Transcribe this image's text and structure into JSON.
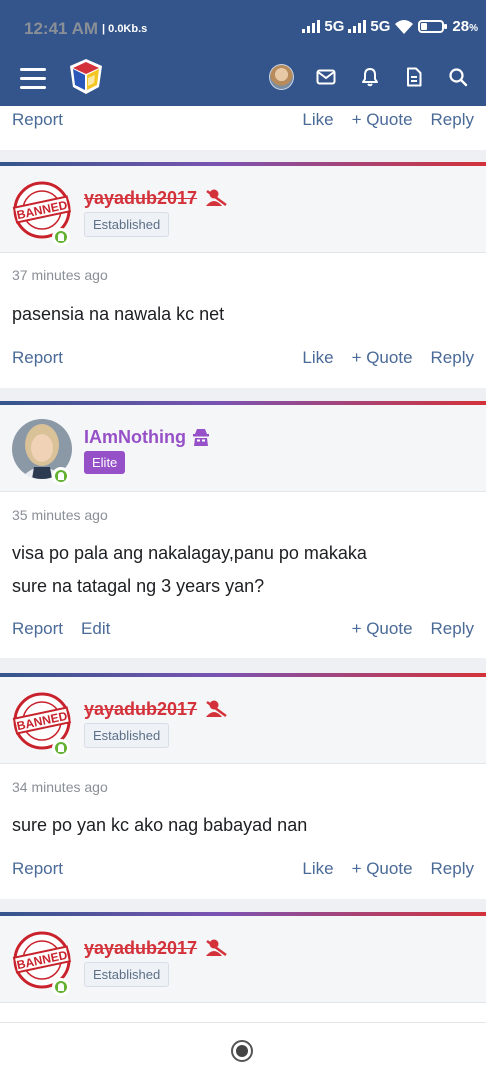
{
  "status_bar": {
    "time": "12:41 AM",
    "speed": "0.0Kb.s",
    "network1": "5G",
    "network2": "5G",
    "battery": "28"
  },
  "actions": {
    "report": "Report",
    "edit": "Edit",
    "like": "Like",
    "quote": "+ Quote",
    "reply": "Reply"
  },
  "posts": [
    {
      "username": "yayadub2017",
      "badge": "Established",
      "time": "37 minutes ago",
      "message": "pasensia na nawala kc net"
    },
    {
      "username": "IAmNothing",
      "badge": "Elite",
      "time": "35 minutes ago",
      "message_line1": "visa po pala ang nakalagay,panu po makaka",
      "message_line2": "sure na tatagal ng 3 years yan?"
    },
    {
      "username": "yayadub2017",
      "badge": "Established",
      "time": "34 minutes ago",
      "message": "sure po yan kc ako nag babayad nan"
    },
    {
      "username": "yayadub2017",
      "badge": "Established"
    }
  ],
  "colors": {
    "header": "#34558b",
    "banned_name": "#d3323a",
    "elite": "#9650c8",
    "link": "#4a6a98"
  }
}
